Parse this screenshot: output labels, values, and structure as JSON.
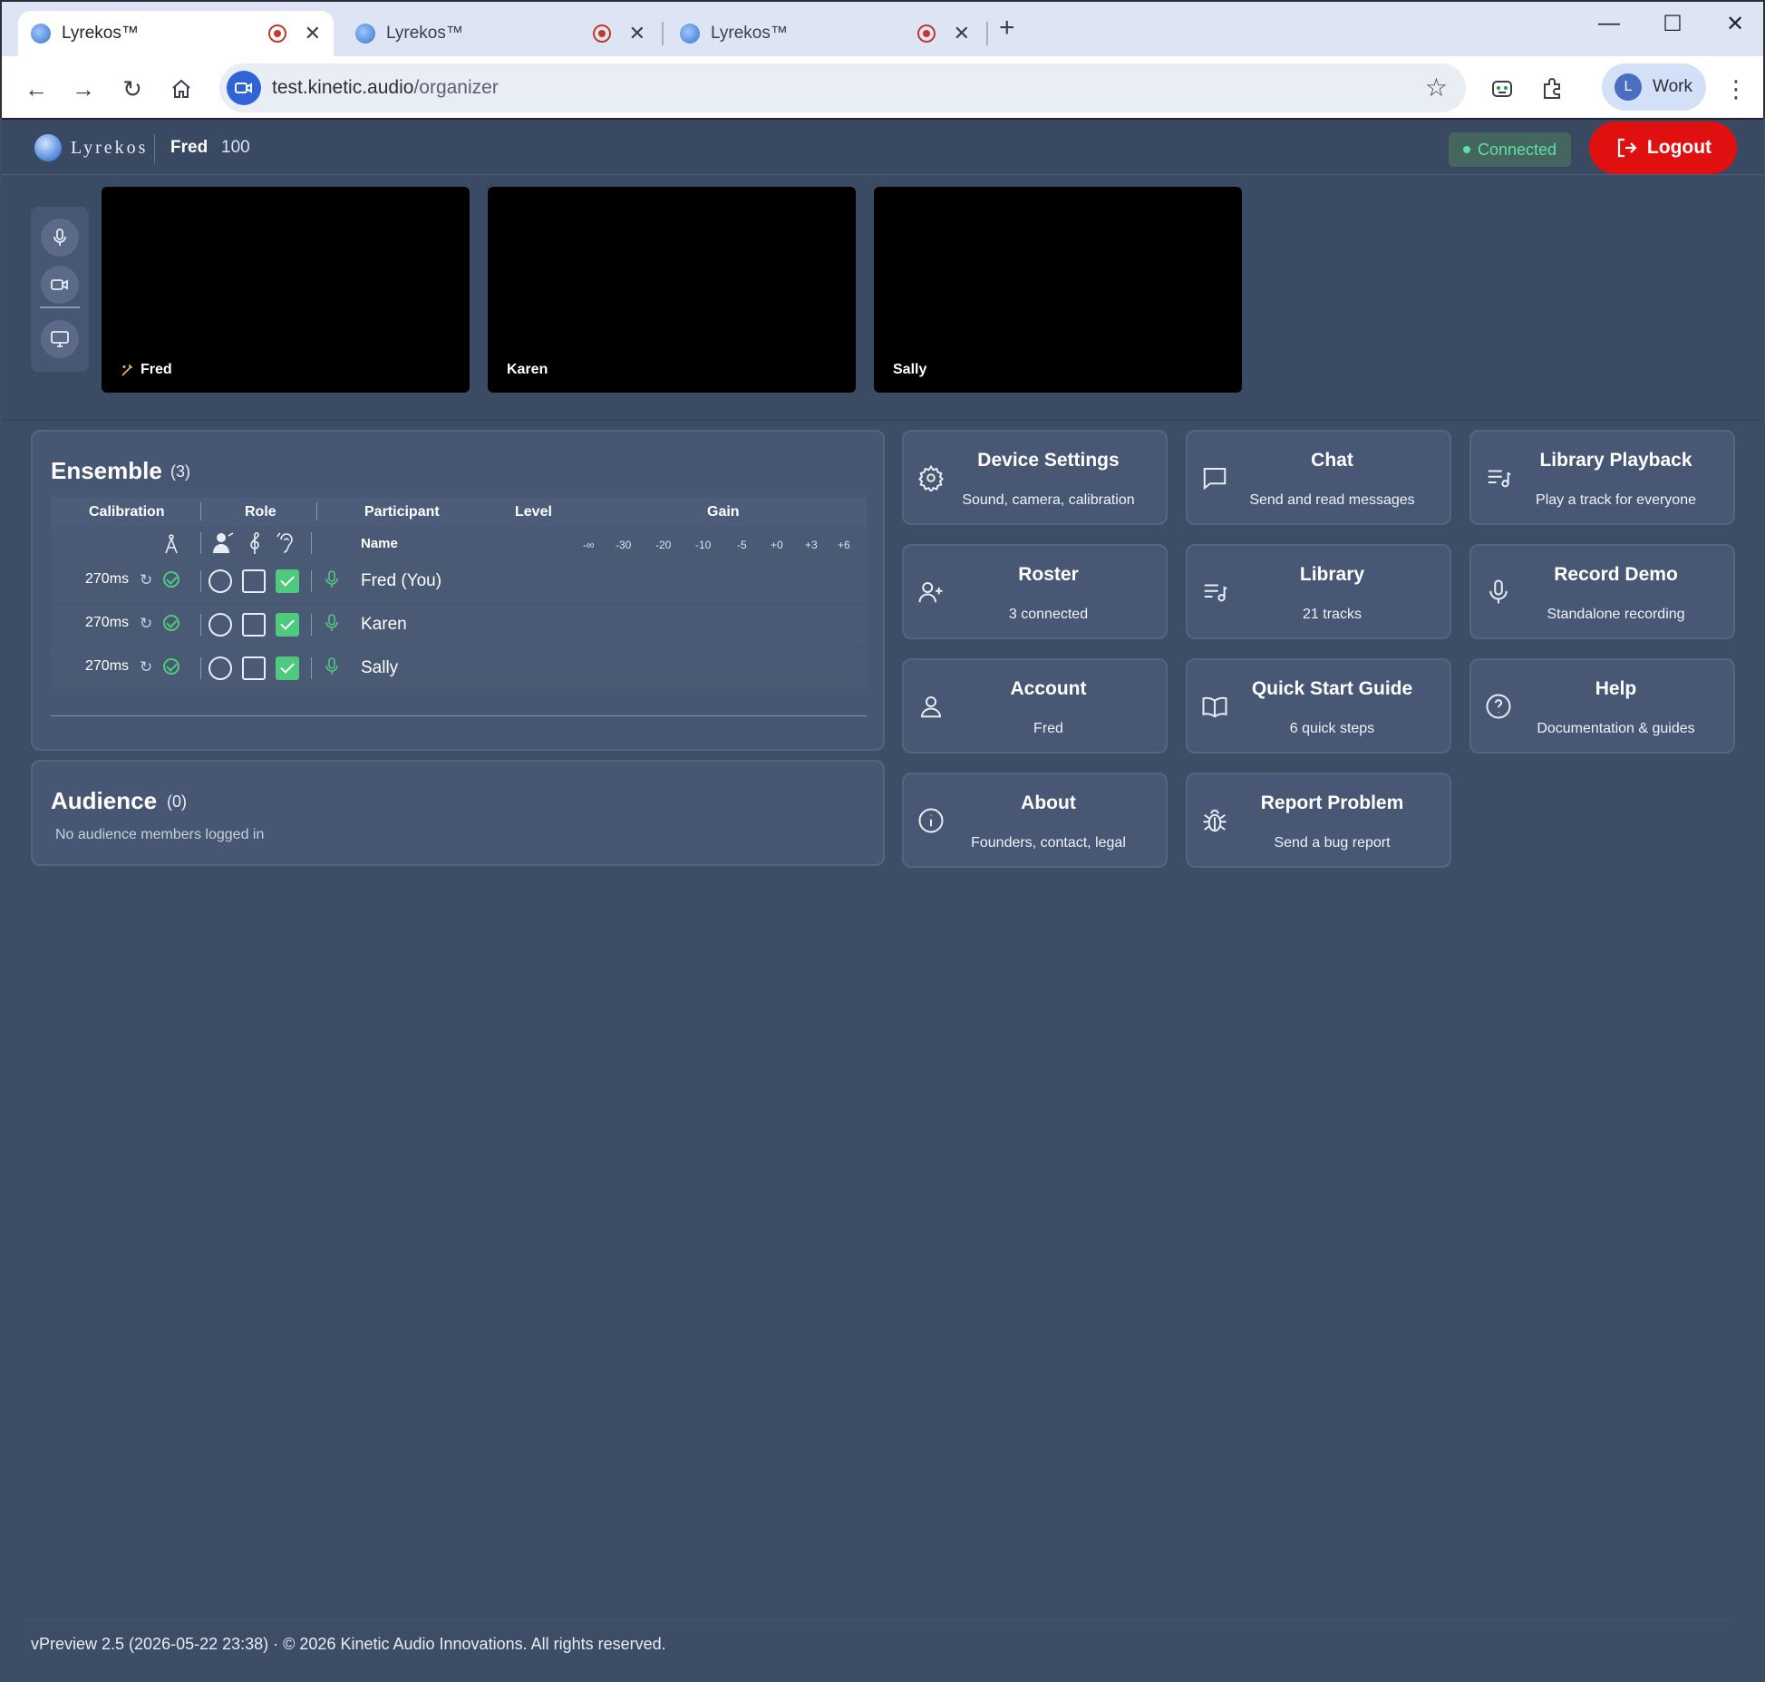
{
  "browser": {
    "tabs": [
      {
        "title": "Lyrekos™"
      },
      {
        "title": "Lyrekos™"
      },
      {
        "title": "Lyrekos™"
      }
    ],
    "url_host": "test.kinetic.audio",
    "url_path": "/organizer",
    "profile_initial": "L",
    "profile_label": "Work"
  },
  "header": {
    "brand": "Lyrekos",
    "user_name": "Fred",
    "user_count": "100",
    "status": "Connected",
    "logout_label": "Logout"
  },
  "videos": [
    {
      "name": "Fred"
    },
    {
      "name": "Karen"
    },
    {
      "name": "Sally"
    }
  ],
  "ensemble": {
    "title": "Ensemble",
    "count": "(3)",
    "columns": {
      "calibration": "Calibration",
      "role": "Role",
      "participant": "Participant",
      "level": "Level",
      "gain": "Gain",
      "name": "Name"
    },
    "gain_ticks": [
      "-∞",
      "-30",
      "-20",
      "-10",
      "-5",
      "+0",
      "+3",
      "+6"
    ],
    "participants": [
      {
        "latency": "270ms",
        "name": "Fred (You)",
        "listener_checked": true
      },
      {
        "latency": "270ms",
        "name": "Karen",
        "listener_checked": true
      },
      {
        "latency": "270ms",
        "name": "Sally",
        "listener_checked": true
      }
    ]
  },
  "audience": {
    "title": "Audience",
    "count": "(0)",
    "empty_text": "No audience members logged in"
  },
  "cards": [
    {
      "title": "Device Settings",
      "subtitle": "Sound, camera, calibration",
      "icon": "gear-icon"
    },
    {
      "title": "Chat",
      "subtitle": "Send and read messages",
      "icon": "chat-icon"
    },
    {
      "title": "Library Playback",
      "subtitle": "Play a track for everyone",
      "icon": "playlist-icon"
    },
    {
      "title": "Roster",
      "subtitle": "3 connected",
      "icon": "user-plus-icon"
    },
    {
      "title": "Library",
      "subtitle": "21 tracks",
      "icon": "music-list-icon"
    },
    {
      "title": "Record Demo",
      "subtitle": "Standalone recording",
      "icon": "microphone-icon"
    },
    {
      "title": "Account",
      "subtitle": "Fred",
      "icon": "user-icon"
    },
    {
      "title": "Quick Start Guide",
      "subtitle": "6 quick steps",
      "icon": "book-icon"
    },
    {
      "title": "Help",
      "subtitle": "Documentation & guides",
      "icon": "help-circle-icon"
    },
    {
      "title": "About",
      "subtitle": "Founders, contact, legal",
      "icon": "info-icon"
    },
    {
      "title": "Report Problem",
      "subtitle": "Send a bug report",
      "icon": "bug-icon"
    }
  ],
  "footer": {
    "text": "vPreview 2.5 (2026-05-22 23:38)  ·  © 2026 Kinetic Audio Innovations. All rights reserved."
  },
  "colors": {
    "background": "#3e4d66",
    "panel": "#475773",
    "accent_green": "#4ec97d",
    "logout_red": "#e01010"
  }
}
